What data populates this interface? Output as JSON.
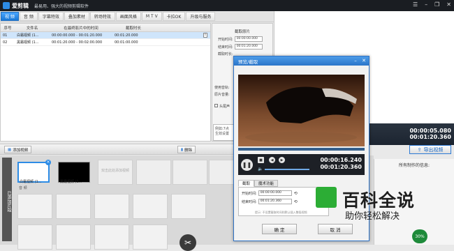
{
  "app": {
    "title": "爱剪辑",
    "slogan": "最易用、强大的视频剪辑软件"
  },
  "menu": [
    "视 频",
    "音 频",
    "字幕特效",
    "叠加素材",
    "转场特效",
    "画面风格",
    "M T V",
    "卡拉OK",
    "升级与服务"
  ],
  "table": {
    "headers": [
      "序号",
      "文件名",
      "在最终影片中的时间",
      "截取时长"
    ],
    "rows": [
      {
        "idx": "01",
        "name": "白霜视频 (1...",
        "range": "00:00:00.000 - 00:01:20.000",
        "dur": "00:01:20.000",
        "icon": "i"
      },
      {
        "idx": "02",
        "name": "黑霜视频 (1...",
        "range": "00:01:20.000 - 00:02:00.000",
        "dur": "00:01:00.000"
      }
    ]
  },
  "settings": {
    "title": "截取原片",
    "start_label": "开始时间:",
    "start_val": "00:00:00.000",
    "end_label": "结束时间:",
    "end_val": "00:01:20.000",
    "dur_label": "截取时长:",
    "use_audio": "使用音轨:",
    "orig_vol": "原片音量:",
    "head_tail": "头尾声",
    "hint": "例如:7点 生效设置"
  },
  "preview": {
    "time_current": "00:00:05.080",
    "time_total": "00:01:20.360"
  },
  "export_label": "导出视频",
  "info_title": "所有制作的信息:",
  "actions": {
    "add_video": "添加视频",
    "delete": "删除"
  },
  "timeline": {
    "tab": "已添加片段",
    "clip1": "白霜视频 (1...",
    "clip2": "黑霜视频 (1...",
    "placeholder": "双击此处添加视频",
    "audio_label": "音 频"
  },
  "dialog": {
    "title": "预览/截取",
    "time_current": "00:00:16.240",
    "time_total": "00:01:20.360",
    "tabs": [
      "截取",
      "魔术功能"
    ],
    "start_label": "开始时间:",
    "start_val": "00:00:00.000",
    "end_label": "结束时间:",
    "end_val": "00:01:20.360",
    "hint": "提示: 不设置截取时间则默认插入整段视频",
    "ok": "确 定",
    "cancel": "取 消"
  },
  "watermark": {
    "main": "百科全说",
    "sub": "助你轻松解决"
  },
  "status_pct": "30%"
}
